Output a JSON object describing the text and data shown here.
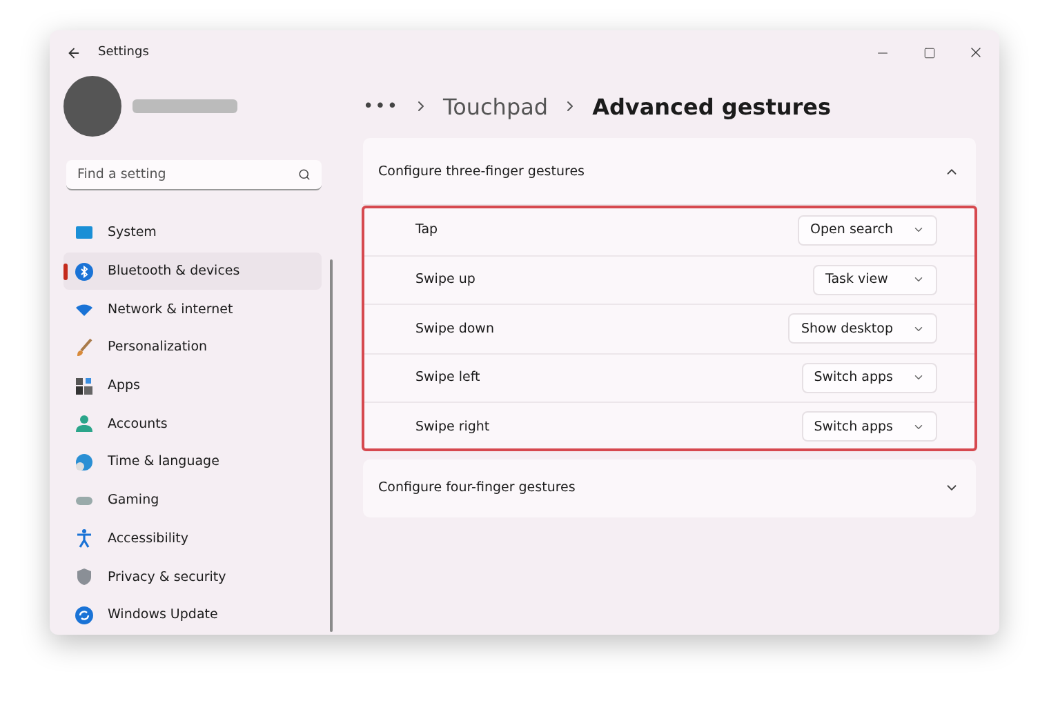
{
  "window": {
    "title": "Settings"
  },
  "sidebar": {
    "search": {
      "placeholder": "Find a setting"
    },
    "items": [
      {
        "label": "System",
        "selected": false
      },
      {
        "label": "Bluetooth & devices",
        "selected": true
      },
      {
        "label": "Network & internet",
        "selected": false
      },
      {
        "label": "Personalization",
        "selected": false
      },
      {
        "label": "Apps",
        "selected": false
      },
      {
        "label": "Accounts",
        "selected": false
      },
      {
        "label": "Time & language",
        "selected": false
      },
      {
        "label": "Gaming",
        "selected": false
      },
      {
        "label": "Accessibility",
        "selected": false
      },
      {
        "label": "Privacy & security",
        "selected": false
      },
      {
        "label": "Windows Update",
        "selected": false
      }
    ]
  },
  "breadcrumb": {
    "overflow": "•••",
    "items": [
      "Touchpad",
      "Advanced gestures"
    ]
  },
  "sections": [
    {
      "title": "Configure three-finger gestures",
      "expanded": true,
      "highlighted": true,
      "rows": [
        {
          "label": "Tap",
          "value": "Open search"
        },
        {
          "label": "Swipe up",
          "value": "Task view"
        },
        {
          "label": "Swipe down",
          "value": "Show desktop"
        },
        {
          "label": "Swipe left",
          "value": "Switch apps"
        },
        {
          "label": "Swipe right",
          "value": "Switch apps"
        }
      ]
    },
    {
      "title": "Configure four-finger gestures",
      "expanded": false
    }
  ]
}
